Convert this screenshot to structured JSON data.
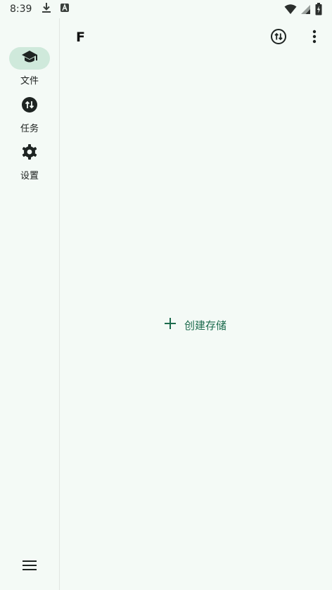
{
  "status_bar": {
    "time": "8:39",
    "left_icons": [
      "download-icon",
      "a-box-icon"
    ],
    "right_icons": [
      "wifi-icon",
      "signal-icon",
      "battery-icon"
    ]
  },
  "nav_rail": {
    "items": [
      {
        "label": "文件",
        "icon": "graduation-cap-icon",
        "active": true
      },
      {
        "label": "任务",
        "icon": "transfer-icon",
        "active": false
      },
      {
        "label": "设置",
        "icon": "gear-icon",
        "active": false
      }
    ],
    "menu_icon": "menu-icon"
  },
  "top_bar": {
    "title": "F",
    "actions": [
      "transfer-outline-icon",
      "more-vert-icon"
    ]
  },
  "empty_state": {
    "create_label": "创建存储",
    "icon": "plus-icon"
  },
  "colors": {
    "background": "#f4faf6",
    "active_indicator": "#cfe9db",
    "accent": "#1c6b4d",
    "icon_dark": "#1e2422"
  }
}
